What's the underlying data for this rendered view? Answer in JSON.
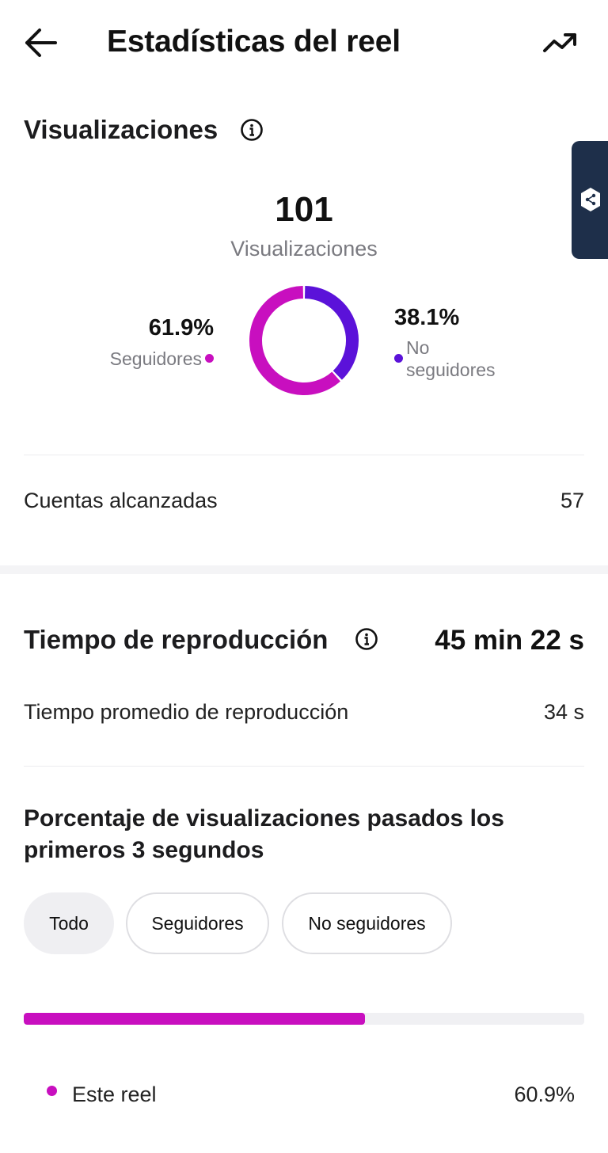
{
  "header": {
    "title": "Estadísticas del reel",
    "back_icon": "arrow-left-icon",
    "trend_icon": "trending-up-icon"
  },
  "views_section": {
    "heading": "Visualizaciones",
    "total": "101",
    "total_label": "Visualizaciones",
    "followers": {
      "percent": "61.9%",
      "label": "Seguidores",
      "color": "#c80fbf",
      "fraction": 0.619
    },
    "non_followers": {
      "percent": "38.1%",
      "label_line1": "No",
      "label_line2": "seguidores",
      "color": "#5b12d9",
      "fraction": 0.381
    },
    "accounts_reached": {
      "label": "Cuentas alcanzadas",
      "value": "57"
    }
  },
  "playtime_section": {
    "heading": "Tiempo de reproducción",
    "total": "45 min 22 s",
    "average": {
      "label": "Tiempo promedio de reproducción",
      "value": "34 s"
    }
  },
  "retention_section": {
    "heading": "Porcentaje de visualizaciones pasados los primeros 3 segundos",
    "chips": [
      "Todo",
      "Seguidores",
      "No seguidores"
    ],
    "active_chip": "Todo",
    "this_reel": {
      "label": "Este reel",
      "value": "60.9%",
      "fraction": 0.609,
      "color": "#c80fbf"
    }
  },
  "colors": {
    "followers": "#c80fbf",
    "non_followers": "#5b12d9",
    "side_tab": "#1e2f4a"
  }
}
